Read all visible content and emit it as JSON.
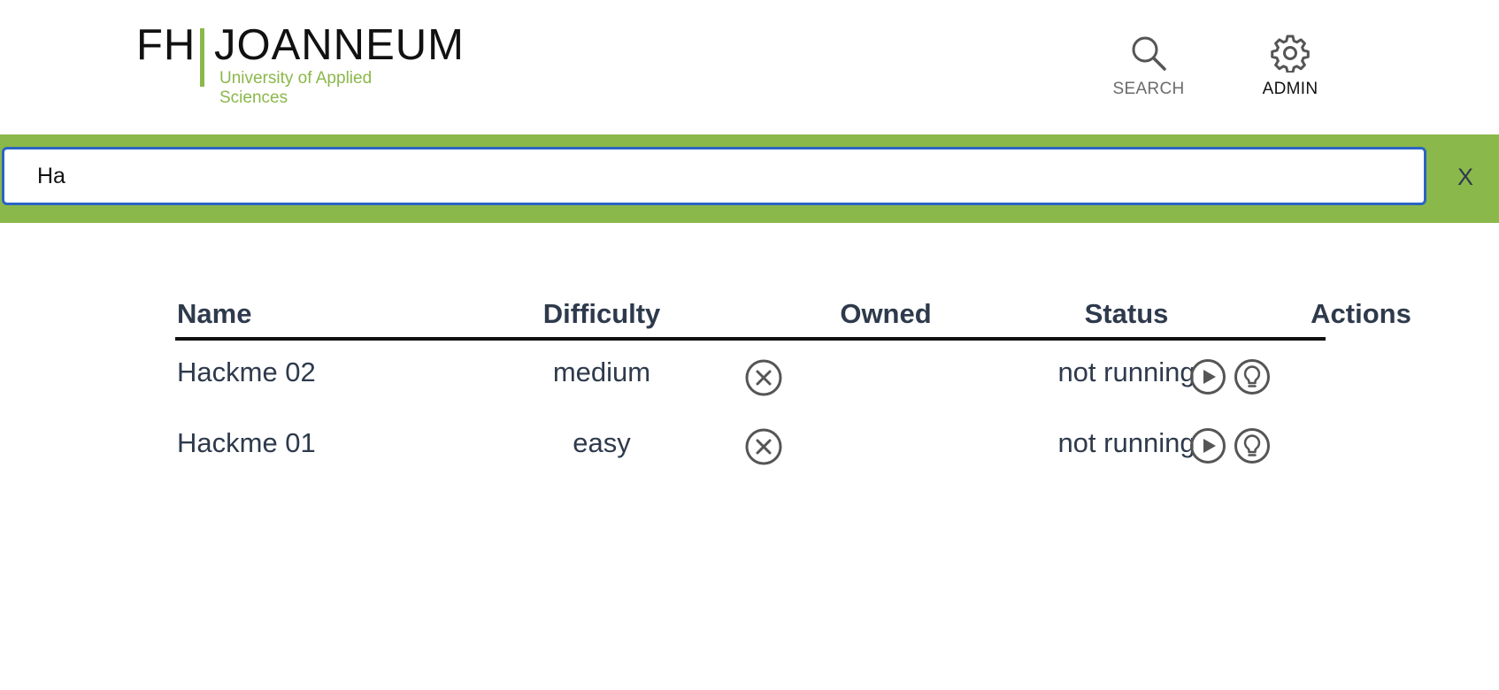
{
  "brand": {
    "logo_fh": "FH",
    "logo_name": "JOANNEUM",
    "logo_subtitle": "University of Applied Sciences",
    "accent_color": "#8bb84a"
  },
  "nav": {
    "search_label": "SEARCH",
    "search_icon": "search-icon",
    "admin_label": "ADMIN",
    "admin_icon": "gear-icon"
  },
  "search": {
    "value": "Ha",
    "close_label": "X"
  },
  "table": {
    "headers": {
      "name": "Name",
      "difficulty": "Difficulty",
      "owned": "Owned",
      "status": "Status",
      "actions": "Actions"
    },
    "rows": [
      {
        "name": "Hackme 02",
        "difficulty": "medium",
        "owned_icon": "not-owned-icon",
        "status": "not running",
        "actions": [
          "play-icon",
          "lightbulb-icon"
        ]
      },
      {
        "name": "Hackme 01",
        "difficulty": "easy",
        "owned_icon": "not-owned-icon",
        "status": "not running",
        "actions": [
          "play-icon",
          "lightbulb-icon"
        ]
      }
    ]
  }
}
